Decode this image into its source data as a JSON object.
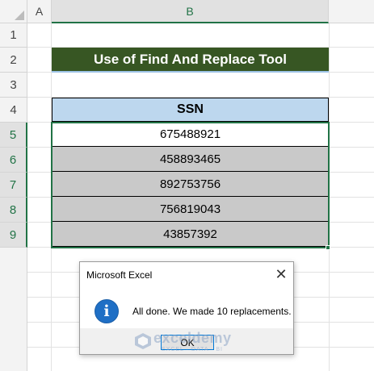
{
  "sheet": {
    "columns": [
      "A",
      "B"
    ],
    "rows": [
      "1",
      "2",
      "3",
      "4",
      "5",
      "6",
      "7",
      "8",
      "9"
    ],
    "title": "Use of Find And Replace Tool",
    "table": {
      "header": "SSN",
      "values": [
        "675488921",
        "458893465",
        "892753756",
        "756819043",
        "43857392"
      ]
    }
  },
  "dialog": {
    "title": "Microsoft Excel",
    "message": "All done. We made 10 replacements.",
    "ok_label": "OK",
    "close_glyph": "✕",
    "info_glyph": "i"
  },
  "watermark": {
    "name": "exceldemy",
    "tagline": "EXCEL · DATA · BI"
  },
  "colors": {
    "title_bg": "#375623",
    "header_bg": "#bdd7ee",
    "cell_bg": "#c9c9c9",
    "selection": "#217346",
    "info_icon": "#1f6fc5"
  }
}
